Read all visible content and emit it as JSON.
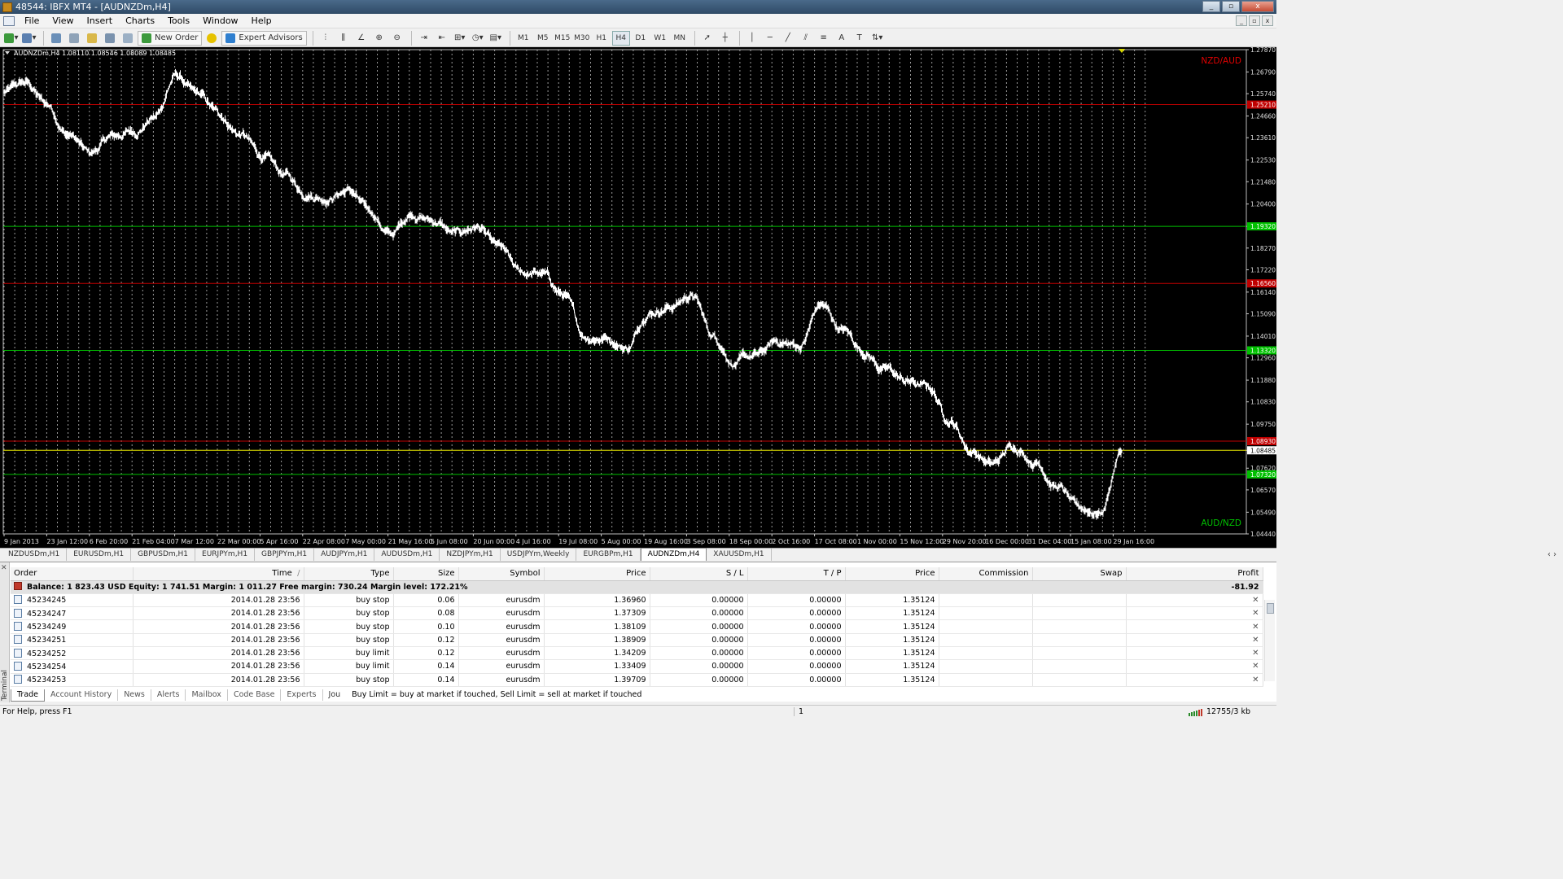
{
  "window": {
    "title": "48544: IBFX MT4 - [AUDNZDm,H4]",
    "buttons": [
      "_",
      "▫",
      "x"
    ]
  },
  "menu": [
    "File",
    "View",
    "Insert",
    "Charts",
    "Tools",
    "Window",
    "Help"
  ],
  "toolbar": {
    "new_order": "New Order",
    "expert_advisors": "Expert Advisors",
    "timeframes": [
      "M1",
      "M5",
      "M15",
      "M30",
      "H1",
      "H4",
      "D1",
      "W1",
      "MN"
    ],
    "active_timeframe": "H4"
  },
  "chart_data": {
    "type": "line",
    "title": "AUDNZDm,H4 1.08110 1.08546 1.08089 1.08485",
    "x_ticks": [
      "9 Jan 2013",
      "23 Jan 12:00",
      "6 Feb 20:00",
      "21 Feb 04:00",
      "7 Mar 12:00",
      "22 Mar 00:00",
      "5 Apr 16:00",
      "22 Apr 08:00",
      "7 May 00:00",
      "21 May 16:00",
      "5 Jun 08:00",
      "20 Jun 00:00",
      "4 Jul 16:00",
      "19 Jul 08:00",
      "5 Aug 00:00",
      "19 Aug 16:00",
      "3 Sep 08:00",
      "18 Sep 00:00",
      "2 Oct 16:00",
      "17 Oct 08:00",
      "1 Nov 00:00",
      "15 Nov 12:00",
      "29 Nov 20:00",
      "16 Dec 00:00",
      "31 Dec 04:00",
      "15 Jan 08:00",
      "29 Jan 16:00"
    ],
    "y_ticks": [
      "1.27870",
      "1.26790",
      "1.25740",
      "1.24660",
      "1.23610",
      "1.22530",
      "1.21480",
      "1.20400",
      "1.19320",
      "1.18270",
      "1.17220",
      "1.16140",
      "1.15090",
      "1.14010",
      "1.12960",
      "1.11880",
      "1.10830",
      "1.09750",
      "1.08485",
      "1.07620",
      "1.06570",
      "1.05490",
      "1.04440"
    ],
    "ylim": [
      1.0444,
      1.2787
    ],
    "grid": true,
    "series": [
      {
        "x": [
          "9 Jan 2013",
          "16 Jan",
          "23 Jan 12:00",
          "30 Jan",
          "6 Feb 20:00",
          "13 Feb",
          "21 Feb 04:00",
          "28 Feb",
          "7 Mar 12:00",
          "14 Mar",
          "22 Mar 00:00",
          "29 Mar",
          "5 Apr 16:00",
          "13 Apr",
          "22 Apr 08:00",
          "29 Apr",
          "7 May 00:00",
          "14 May",
          "21 May 16:00",
          "28 May",
          "5 Jun 08:00",
          "12 Jun",
          "20 Jun 00:00",
          "27 Jun",
          "4 Jul 16:00",
          "11 Jul",
          "19 Jul 08:00",
          "27 Jul",
          "5 Aug 00:00",
          "12 Aug",
          "19 Aug 16:00",
          "27 Aug",
          "3 Sep 08:00",
          "10 Sep",
          "18 Sep 00:00",
          "25 Sep",
          "2 Oct 16:00",
          "9 Oct",
          "17 Oct 08:00",
          "24 Oct",
          "1 Nov 00:00",
          "8 Nov",
          "15 Nov 12:00",
          "22 Nov",
          "29 Nov 20:00",
          "7 Dec",
          "16 Dec 00:00",
          "23 Dec",
          "31 Dec 04:00",
          "7 Jan",
          "15 Jan 08:00",
          "22 Jan",
          "29 Jan 16:00"
        ],
        "values": [
          1.258,
          1.262,
          1.252,
          1.238,
          1.228,
          1.236,
          1.239,
          1.246,
          1.266,
          1.256,
          1.247,
          1.238,
          1.227,
          1.218,
          1.21,
          1.208,
          1.211,
          1.2,
          1.189,
          1.2,
          1.196,
          1.189,
          1.193,
          1.182,
          1.17,
          1.17,
          1.16,
          1.14,
          1.14,
          1.135,
          1.153,
          1.155,
          1.16,
          1.14,
          1.128,
          1.13,
          1.137,
          1.135,
          1.155,
          1.143,
          1.133,
          1.124,
          1.118,
          1.115,
          1.1,
          1.085,
          1.078,
          1.087,
          1.08,
          1.068,
          1.056,
          1.055,
          1.0845
        ]
      }
    ],
    "price_lines": [
      {
        "value": 1.2521,
        "label": "1.25210",
        "color": "#c00000"
      },
      {
        "value": 1.1932,
        "label": "1.19320",
        "color": "#00c000"
      },
      {
        "value": 1.1656,
        "label": "1.16560",
        "color": "#c00000"
      },
      {
        "value": 1.1332,
        "label": "1.13320",
        "color": "#00c000"
      },
      {
        "value": 1.0893,
        "label": "1.08930",
        "color": "#c00000"
      },
      {
        "value": 1.08485,
        "label": "1.08485",
        "color": "#e6e600"
      },
      {
        "value": 1.0732,
        "label": "1.07320",
        "color": "#00c000"
      }
    ],
    "annotations": [
      {
        "text": "NZD/AUD",
        "color": "#e00000"
      },
      {
        "text": "AUD/NZD",
        "color": "#00c000"
      }
    ]
  },
  "symbol_tabs": [
    "NZDUSDm,H1",
    "EURUSDm,H1",
    "GBPUSDm,H1",
    "EURJPYm,H1",
    "GBPJPYm,H1",
    "AUDJPYm,H1",
    "AUDUSDm,H1",
    "NZDJPYm,H1",
    "USDJPYm,Weekly",
    "EURGBPm,H1",
    "AUDNZDm,H4",
    "XAUUSDm,H1"
  ],
  "active_symbol_tab": "AUDNZDm,H4",
  "terminal": {
    "side_label": "Terminal",
    "columns": [
      "Order",
      "Time",
      "Type",
      "Size",
      "Symbol",
      "Price",
      "S / L",
      "T / P",
      "Price",
      "Commission",
      "Swap",
      "Profit"
    ],
    "sort_indicator": "/",
    "balance_row": {
      "text": "Balance: 1 823.43 USD  Equity: 1 741.51  Margin: 1 011.27  Free margin: 730.24  Margin level: 172.21%",
      "profit": "-81.92"
    },
    "rows": [
      {
        "order": "45234245",
        "time": "2014.01.28 23:56",
        "type": "buy stop",
        "size": "0.06",
        "symbol": "eurusdm",
        "price": "1.36960",
        "sl": "0.00000",
        "tp": "0.00000",
        "cur_price": "1.35124"
      },
      {
        "order": "45234247",
        "time": "2014.01.28 23:56",
        "type": "buy stop",
        "size": "0.08",
        "symbol": "eurusdm",
        "price": "1.37309",
        "sl": "0.00000",
        "tp": "0.00000",
        "cur_price": "1.35124"
      },
      {
        "order": "45234249",
        "time": "2014.01.28 23:56",
        "type": "buy stop",
        "size": "0.10",
        "symbol": "eurusdm",
        "price": "1.38109",
        "sl": "0.00000",
        "tp": "0.00000",
        "cur_price": "1.35124"
      },
      {
        "order": "45234251",
        "time": "2014.01.28 23:56",
        "type": "buy stop",
        "size": "0.12",
        "symbol": "eurusdm",
        "price": "1.38909",
        "sl": "0.00000",
        "tp": "0.00000",
        "cur_price": "1.35124"
      },
      {
        "order": "45234252",
        "time": "2014.01.28 23:56",
        "type": "buy limit",
        "size": "0.12",
        "symbol": "eurusdm",
        "price": "1.34209",
        "sl": "0.00000",
        "tp": "0.00000",
        "cur_price": "1.35124"
      },
      {
        "order": "45234254",
        "time": "2014.01.28 23:56",
        "type": "buy limit",
        "size": "0.14",
        "symbol": "eurusdm",
        "price": "1.33409",
        "sl": "0.00000",
        "tp": "0.00000",
        "cur_price": "1.35124"
      },
      {
        "order": "45234253",
        "time": "2014.01.28 23:56",
        "type": "buy stop",
        "size": "0.14",
        "symbol": "eurusdm",
        "price": "1.39709",
        "sl": "0.00000",
        "tp": "0.00000",
        "cur_price": "1.35124"
      }
    ],
    "tabs": [
      "Trade",
      "Account History",
      "News",
      "Alerts",
      "Mailbox",
      "Code Base",
      "Experts",
      "Jou"
    ],
    "active_tab": "Trade",
    "hint": "Buy Limit = buy at market if touched, Sell Limit = sell at market if touched"
  },
  "status": {
    "help": "For Help, press F1",
    "profile": "1",
    "traffic": "12755/3 kb"
  }
}
